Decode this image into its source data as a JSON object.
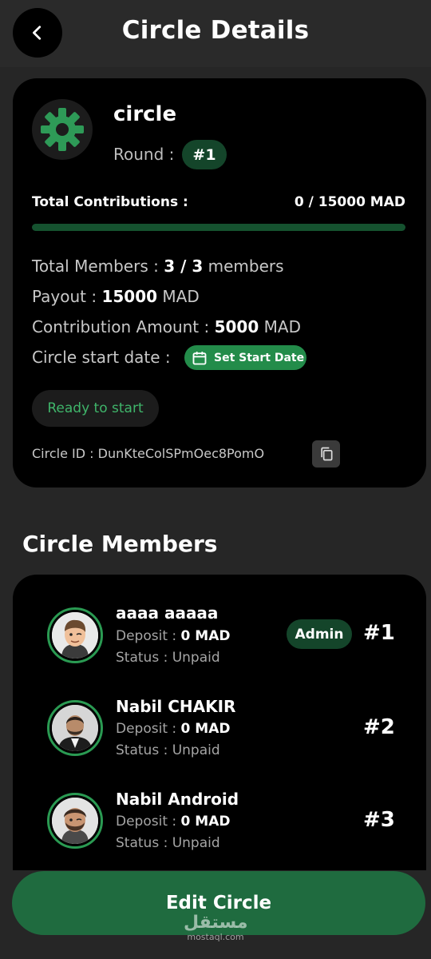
{
  "header": {
    "title": "Circle Details",
    "back_icon": "chevron-left-icon"
  },
  "circle": {
    "name": "circle",
    "round_label": "Round :",
    "round_value": "#1",
    "contributions_label": "Total Contributions :",
    "contributions_value": "0 / 15000 MAD",
    "contributions_progress": 0,
    "members_label": "Total Members :",
    "members_value": "3 / 3",
    "members_unit": "members",
    "payout_label": "Payout :",
    "payout_value": "15000",
    "payout_unit": "MAD",
    "amount_label": "Contribution Amount :",
    "amount_value": "5000",
    "amount_unit": "MAD",
    "start_date_label": "Circle start date :",
    "set_start_date": "Set Start Date",
    "status": "Ready to start",
    "id_text": "Circle ID : DunKteColSPmOec8PomO"
  },
  "members_section": {
    "title": "Circle Members",
    "members": [
      {
        "name": "aaaa aaaaa",
        "deposit_label": "Deposit :",
        "deposit_value": "0 MAD",
        "status": "Status : Unpaid",
        "role": "Admin",
        "rank": "#1"
      },
      {
        "name": "Nabil CHAKIR",
        "deposit_label": "Deposit :",
        "deposit_value": "0 MAD",
        "status": "Status : Unpaid",
        "rank": "#2"
      },
      {
        "name": "Nabil Android",
        "deposit_label": "Deposit :",
        "deposit_value": "0 MAD",
        "status": "Status : Unpaid",
        "rank": "#3"
      }
    ]
  },
  "actions": {
    "edit_label": "Edit Circle"
  },
  "watermark": {
    "arabic": "مستقل",
    "latin": "mostaql.com"
  },
  "colors": {
    "background": "#262626",
    "card": "#000000",
    "accent_green": "#238c4a",
    "badge_green": "#14452a",
    "status_green": "#3fb56a",
    "button_green": "#1f6b3f"
  }
}
